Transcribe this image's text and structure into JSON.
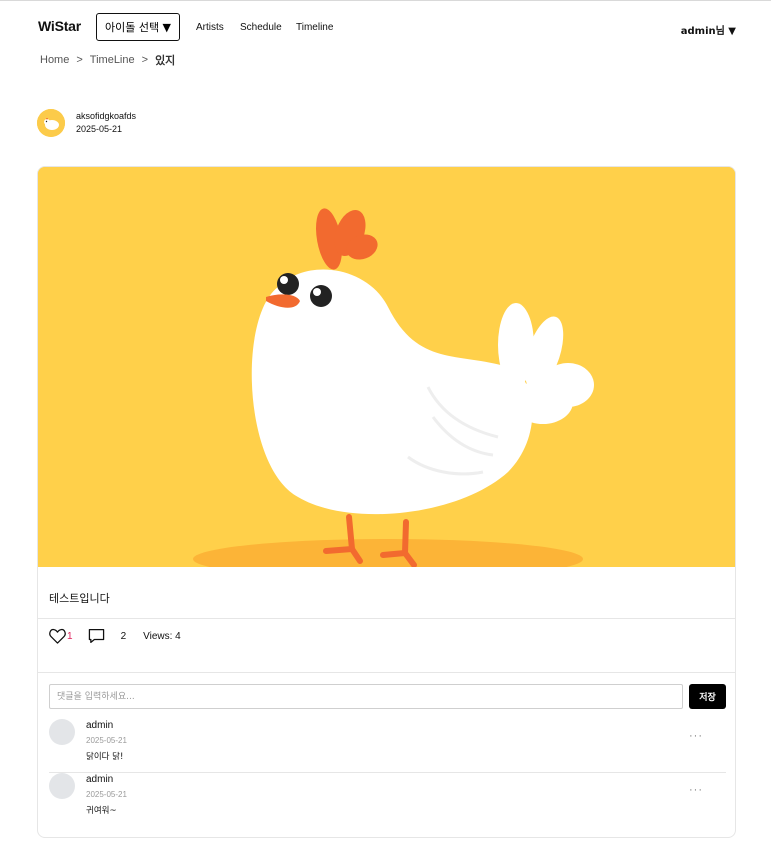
{
  "header": {
    "logo": "WiStar",
    "idol_select_label": "아이돌 선택 ▼",
    "nav": {
      "artists": "Artists",
      "schedule": "Schedule",
      "timeline": "Timeline"
    },
    "user_menu": "admin님 ▼"
  },
  "breadcrumb": {
    "home": "Home",
    "sep1": ">",
    "timeline": "TimeLine",
    "sep2": ">",
    "current": "있지"
  },
  "post": {
    "author": "aksofidgkoafds",
    "date": "2025-05-21",
    "image_alt": "chicken-illustration",
    "text": "테스트입니다",
    "like_count": "1",
    "comment_count": "2",
    "views": "Views: 4"
  },
  "comment_form": {
    "placeholder": "댓글을 입력하세요...",
    "save_label": "저장"
  },
  "comments": [
    {
      "author": "admin",
      "date": "2025-05-21",
      "text": "닭이다 닭!",
      "more": "···"
    },
    {
      "author": "admin",
      "date": "2025-05-21",
      "text": "귀여워~",
      "more": "···"
    }
  ],
  "colors": {
    "image_bg": "#ffd04a",
    "like_count": "#e0245e",
    "save_button": "#000000"
  }
}
